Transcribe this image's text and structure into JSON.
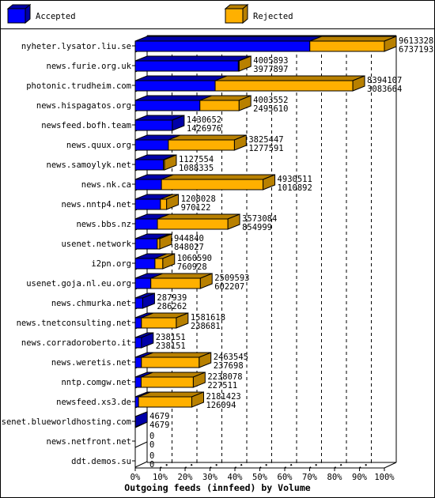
{
  "chart_data": {
    "type": "bar",
    "orientation": "horizontal",
    "stacked": true,
    "style": "3d",
    "title": "",
    "xlabel": "Outgoing feeds (innfeed) by Volume",
    "ylabel": "",
    "xlim": [
      0,
      100
    ],
    "x_unit": "%",
    "x_ticks": [
      "0%",
      "10%",
      "20%",
      "30%",
      "40%",
      "50%",
      "60%",
      "70%",
      "80%",
      "90%",
      "100%"
    ],
    "grid": true,
    "legend_position": "top",
    "legend": [
      {
        "name": "Accepted",
        "color": "#0000ff"
      },
      {
        "name": "Rejected",
        "color": "#ffb000"
      }
    ],
    "categories": [
      "nyheter.lysator.liu.se",
      "news.furie.org.uk",
      "photonic.trudheim.com",
      "news.hispagatos.org",
      "newsfeed.bofh.team",
      "news.quux.org",
      "news.samoylyk.net",
      "news.nk.ca",
      "news.nntp4.net",
      "news.bbs.nz",
      "usenet.network",
      "i2pn.org",
      "usenet.goja.nl.eu.org",
      "news.chmurka.net",
      "news.tnetconsulting.net",
      "news.corradoroberto.it",
      "news.weretis.net",
      "nntp.comgw.net",
      "newsfeed.xs3.de",
      "usenet.blueworldhosting.com",
      "news.netfront.net",
      "ddt.demos.su"
    ],
    "totals": [
      9613328,
      4005893,
      8394107,
      4003552,
      1430652,
      3825447,
      1127554,
      4930511,
      1208028,
      3573084,
      944840,
      1060590,
      2509593,
      287939,
      1581618,
      238151,
      2463545,
      2238078,
      2181423,
      4679,
      0,
      0
    ],
    "accepted": [
      6737193,
      3977897,
      3083664,
      2495610,
      1426976,
      1277591,
      1088335,
      1010892,
      970122,
      854999,
      848027,
      760928,
      602207,
      286262,
      238681,
      238151,
      237698,
      227511,
      126094,
      4679,
      0,
      0
    ]
  },
  "colors": {
    "accepted_front": "#0000ff",
    "accepted_top": "#0000a8",
    "rejected_front": "#ffb000",
    "rejected_top": "#b88000"
  }
}
